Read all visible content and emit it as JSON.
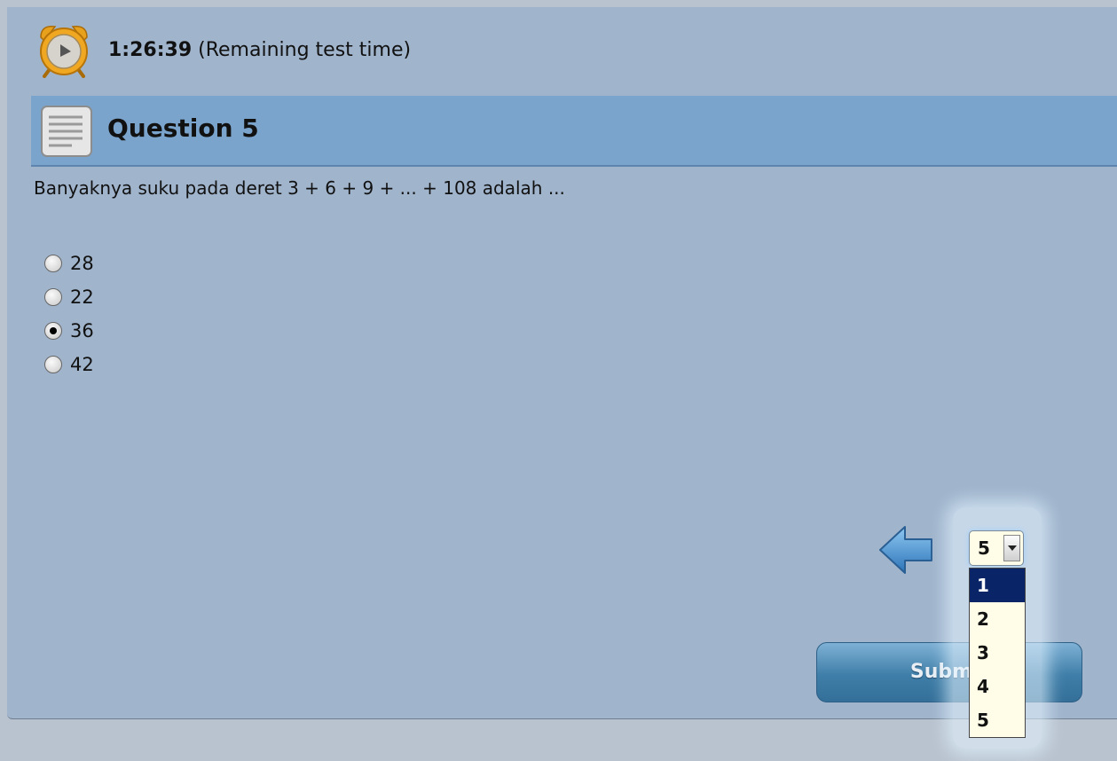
{
  "timer": {
    "value": "1:26:39",
    "label": "(Remaining test time)"
  },
  "question": {
    "title": "Question 5",
    "text": "Banyaknya suku pada deret 3 + 6 + 9 + ... + 108 adalah ...",
    "options": [
      {
        "label": "28",
        "selected": false
      },
      {
        "label": "22",
        "selected": false
      },
      {
        "label": "36",
        "selected": true
      },
      {
        "label": "42",
        "selected": false
      }
    ]
  },
  "navigation": {
    "current_question": "5",
    "question_list": [
      "1",
      "2",
      "3",
      "4",
      "5"
    ],
    "highlighted_option": "1"
  },
  "submit_label": "Submit",
  "icons": {
    "timer": "alarm-clock-icon",
    "question": "document-icon",
    "prev": "left-arrow-icon"
  },
  "colors": {
    "panel": "#a0b4cc",
    "header": "#7aa4cc",
    "submit": "#3f7ea8",
    "dropdown_highlight": "#0a2468"
  }
}
